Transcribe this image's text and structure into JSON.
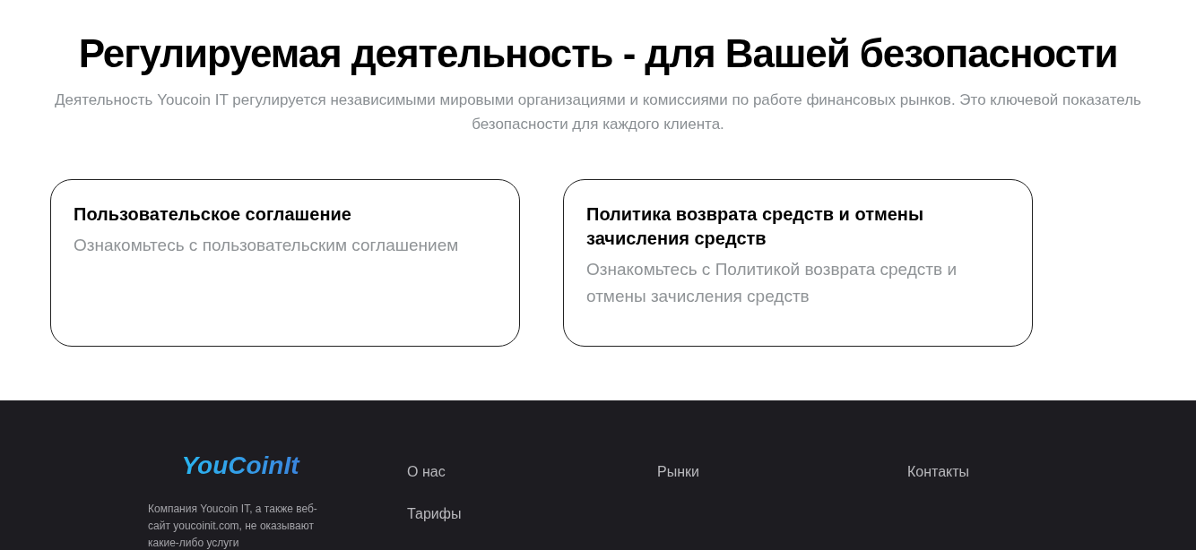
{
  "header": {
    "title": "Регулируемая деятельность - для Вашей безопасности",
    "subtitle": "Деятельность Youcoin IT регулируется независимыми мировыми организациями и комиссиями по работе финансовых рынков. Это ключевой показатель безопасности для каждого клиента."
  },
  "cards": [
    {
      "title": "Пользовательское соглашение",
      "text": "Ознакомьтесь с пользовательским соглашением"
    },
    {
      "title": "Политика возврата средств и отмены зачисления средств",
      "text": "Ознакомьтесь с Политикой возврата средств и отмены зачисления средств"
    }
  ],
  "footer": {
    "logo": "YouCoinIt",
    "description": "Компания Youcoin IT, а также веб-сайт youcoinit.com, не оказывают какие-либо услуги",
    "columns": [
      [
        "О нас",
        "Тарифы"
      ],
      [
        "Рынки"
      ],
      [
        "Контакты"
      ]
    ]
  }
}
